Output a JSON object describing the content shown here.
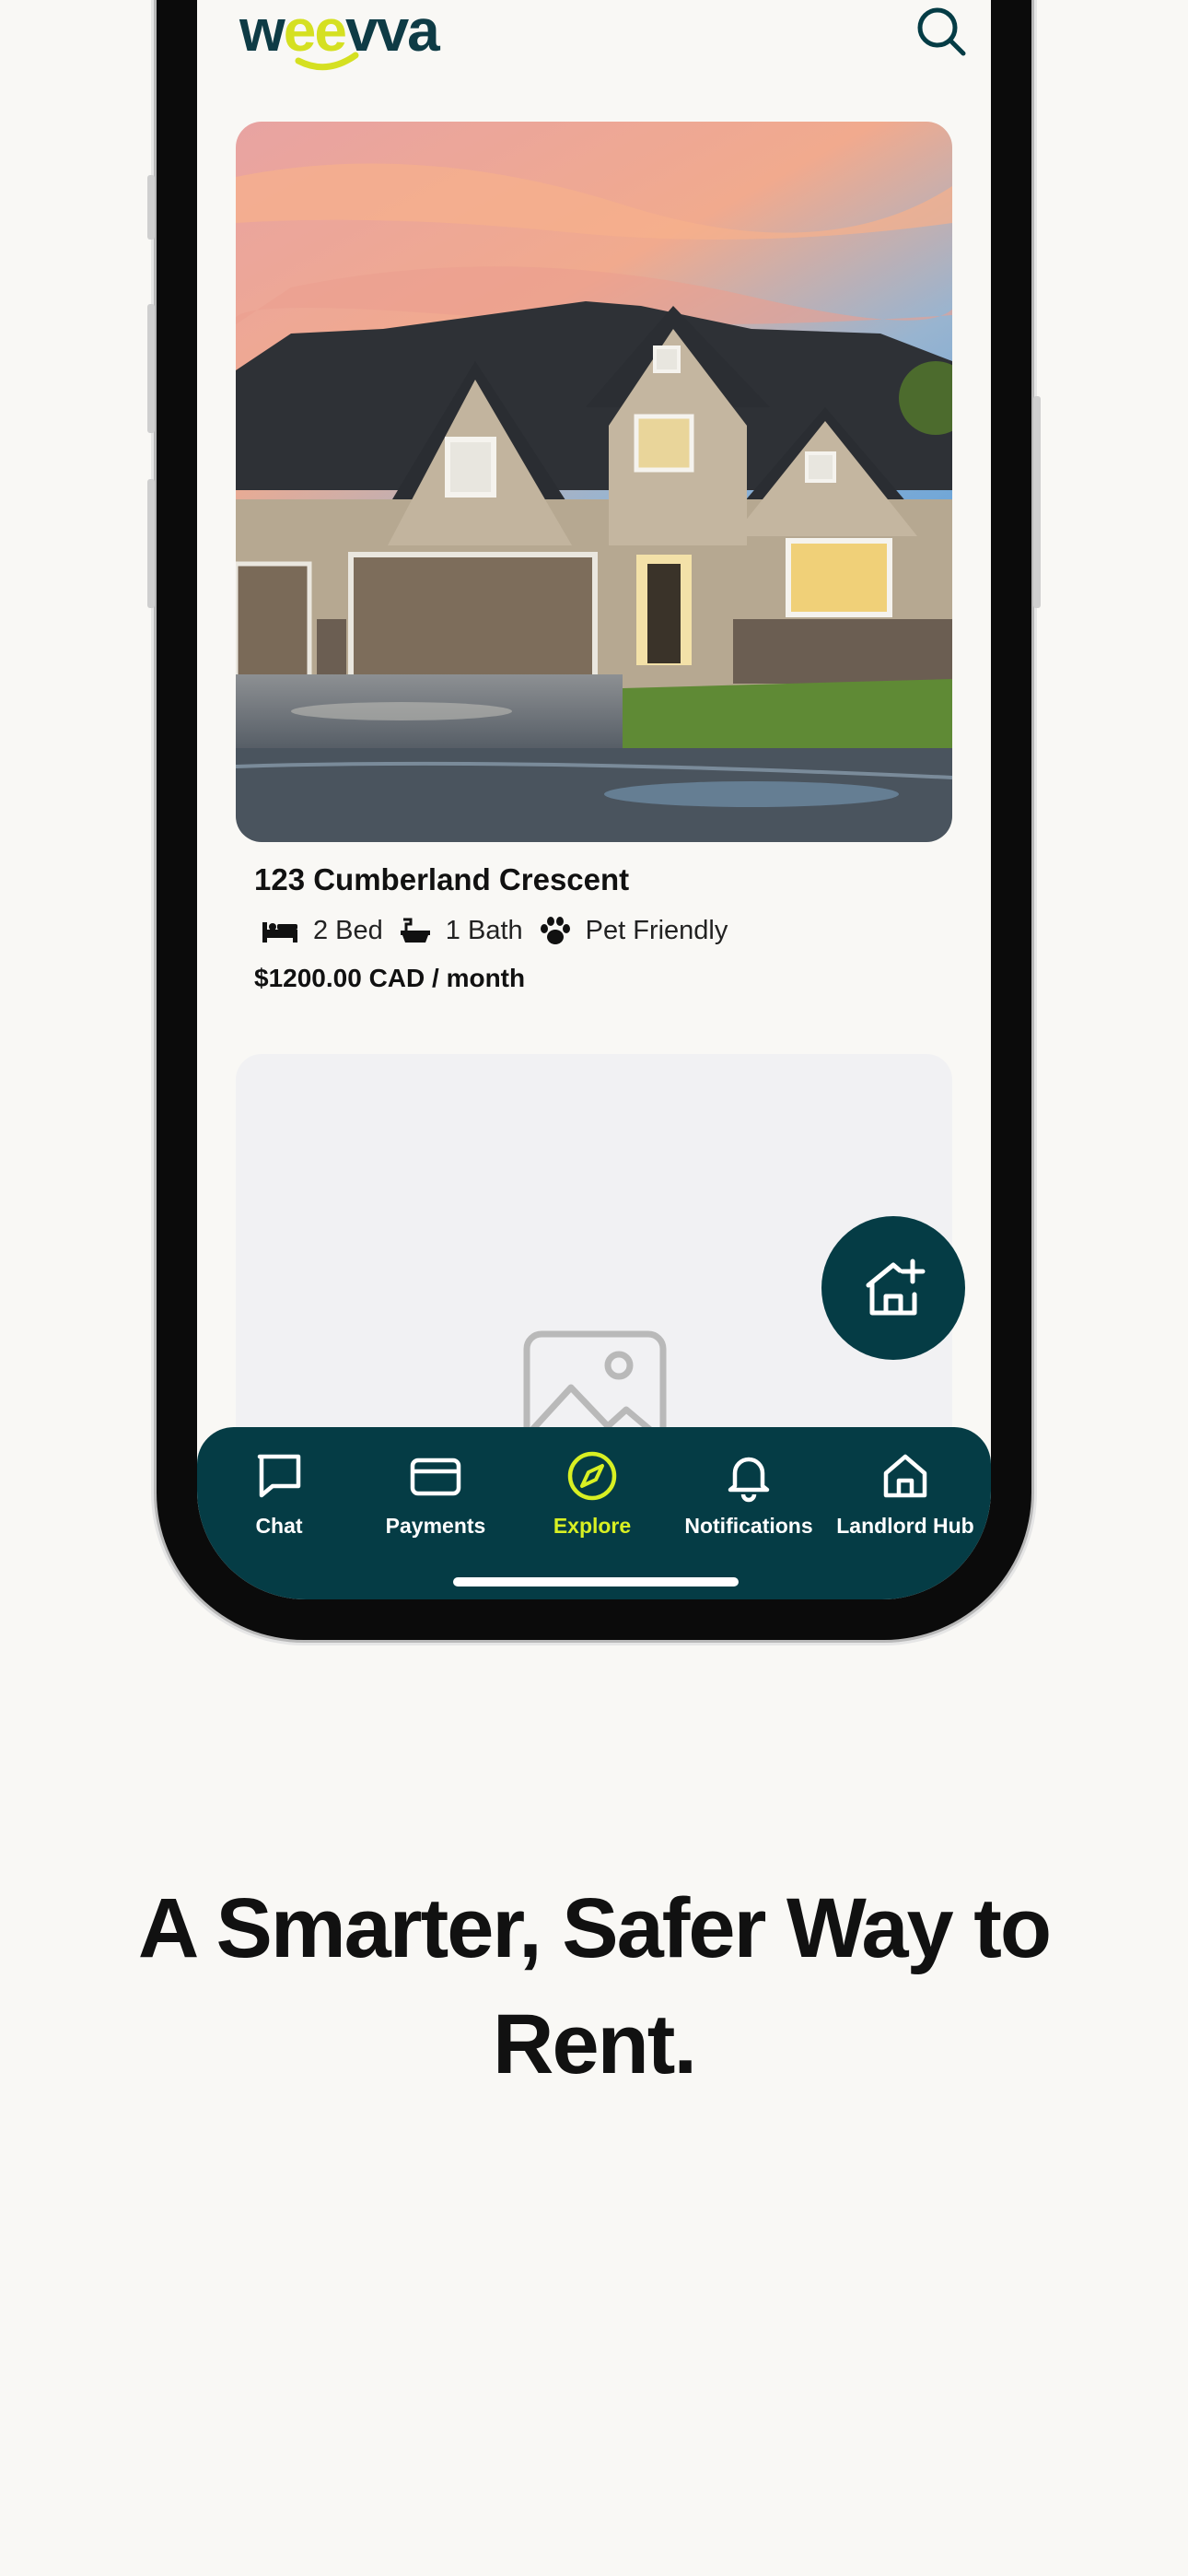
{
  "app": {
    "logo_prefix": "w",
    "logo_accent": "ee",
    "logo_suffix": "vva",
    "brand_color": "#053c45",
    "accent_color": "#d8f023"
  },
  "header": {
    "search_icon": "search-icon"
  },
  "listing": {
    "title": "123 Cumberland Crescent",
    "beds": "2 Bed",
    "baths": "1 Bath",
    "pets": "Pet Friendly",
    "price": "$1200.00 CAD / month"
  },
  "fab": {
    "icon": "add-home-icon"
  },
  "tabs": [
    {
      "label": "Chat",
      "icon": "chat-icon"
    },
    {
      "label": "Payments",
      "icon": "card-icon"
    },
    {
      "label": "Explore",
      "icon": "compass-icon",
      "active": true
    },
    {
      "label": "Notifications",
      "icon": "bell-icon"
    },
    {
      "label": "Landlord Hub",
      "icon": "home-icon"
    }
  ],
  "tagline": "A Smarter, Safer Way to Rent."
}
